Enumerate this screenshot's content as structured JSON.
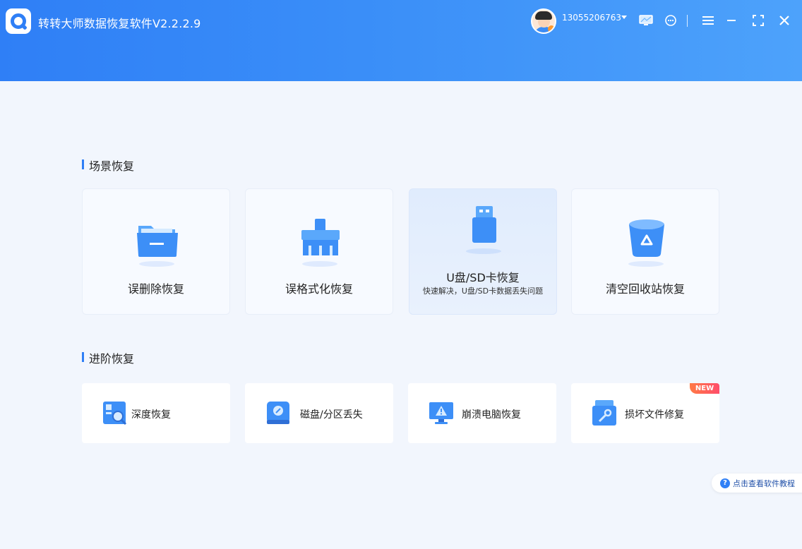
{
  "header": {
    "app_title": "转转大师数据恢复软件V2.2.2.9",
    "user_phone": "13055206763",
    "icons": [
      "app-logo-icon",
      "avatar",
      "caret-down-icon",
      "monitor-icon",
      "chat-icon",
      "menu-icon",
      "minimize-icon",
      "maximize-icon",
      "close-icon"
    ]
  },
  "sections": {
    "scene_title": "场景恢复",
    "advanced_title": "进阶恢复"
  },
  "scene_cards": [
    {
      "label": "误删除恢复",
      "icon": "folder-icon"
    },
    {
      "label": "误格式化恢复",
      "icon": "brush-icon"
    },
    {
      "label": "U盘/SD卡恢复",
      "sub": "快速解决，U盘/SD卡数据丢失问题",
      "icon": "usb-drive-icon",
      "active": true
    },
    {
      "label": "清空回收站恢复",
      "icon": "recycle-bin-icon"
    }
  ],
  "advanced_cards": [
    {
      "label": "深度恢复",
      "icon": "deep-scan-icon"
    },
    {
      "label": "磁盘/分区丢失",
      "icon": "disk-icon"
    },
    {
      "label": "崩溃电脑恢复",
      "icon": "crashed-monitor-icon"
    },
    {
      "label": "损坏文件修复",
      "icon": "file-repair-icon",
      "badge": "NEW"
    }
  ],
  "help": {
    "label": "点击查看软件教程"
  },
  "colors": {
    "primary": "#2f7ff6",
    "background": "#f2f6fd",
    "badge": "#ff5a5f"
  }
}
